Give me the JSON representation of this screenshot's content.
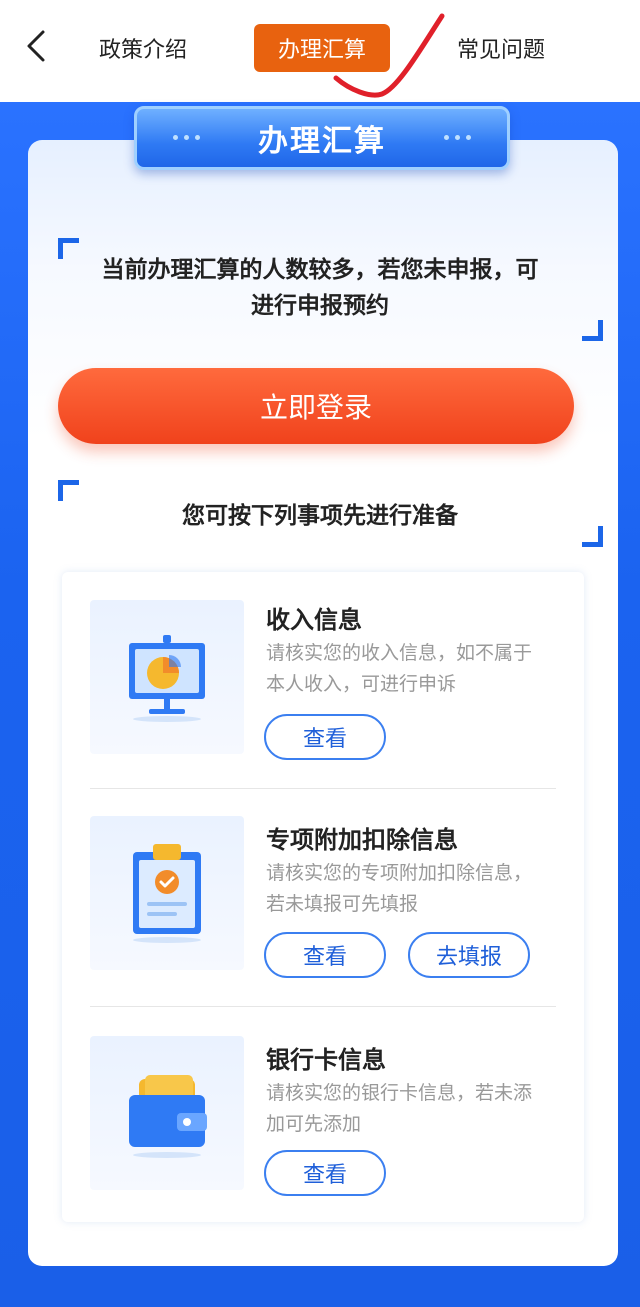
{
  "header": {
    "back_icon": "chevron-left-icon",
    "tabs": [
      {
        "label": "政策介绍",
        "active": false
      },
      {
        "label": "办理汇算",
        "active": true
      },
      {
        "label": "常见问题",
        "active": false
      }
    ],
    "active_color": "#e8620f"
  },
  "card": {
    "banner_title": "办理汇算",
    "notice_line1": "当前办理汇算的人数较多，若您未申报，可",
    "notice_line2": "进行申报预约",
    "login_button": "立即登录",
    "prep_title": "您可按下列事项先进行准备"
  },
  "items": [
    {
      "icon": "presentation-chart-icon",
      "title": "收入信息",
      "desc_line1": "请核实您的收入信息，如不属于",
      "desc_line2": "本人收入，可进行申诉",
      "buttons": [
        "查看"
      ]
    },
    {
      "icon": "clipboard-check-icon",
      "title": "专项附加扣除信息",
      "desc_line1": "请核实您的专项附加扣除信息，",
      "desc_line2": "若未填报可先填报",
      "buttons": [
        "查看",
        "去填报"
      ]
    },
    {
      "icon": "wallet-icon",
      "title": "银行卡信息",
      "desc_line1": "请核实您的银行卡信息，若未添",
      "desc_line2": "加可先添加",
      "buttons": [
        "查看"
      ]
    }
  ],
  "colors": {
    "primary_blue": "#1b63f0",
    "login_red": "#f0421c",
    "pill_border": "#3b7ff0",
    "annotation_red": "#e0202a"
  }
}
